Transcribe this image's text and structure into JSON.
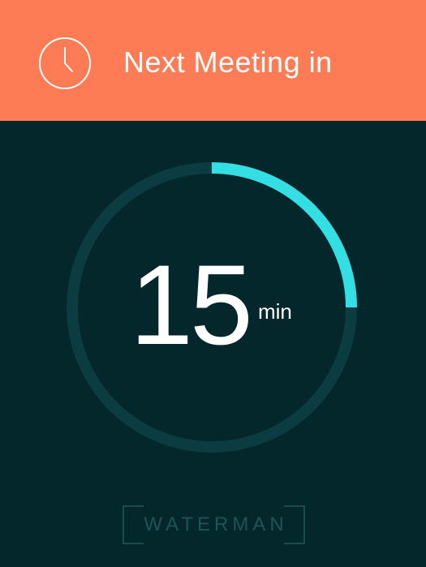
{
  "header": {
    "title": "Next Meeting in",
    "icon": "clock-icon",
    "background_color": "#fd7c55"
  },
  "timer": {
    "value": "15",
    "unit": "min",
    "progress_fraction": 0.25,
    "track_color": "#0a3c42",
    "progress_color": "#33dfe3"
  },
  "brand": {
    "name": "WATERMAN"
  },
  "colors": {
    "background": "#03272b",
    "text": "#ffffff"
  }
}
